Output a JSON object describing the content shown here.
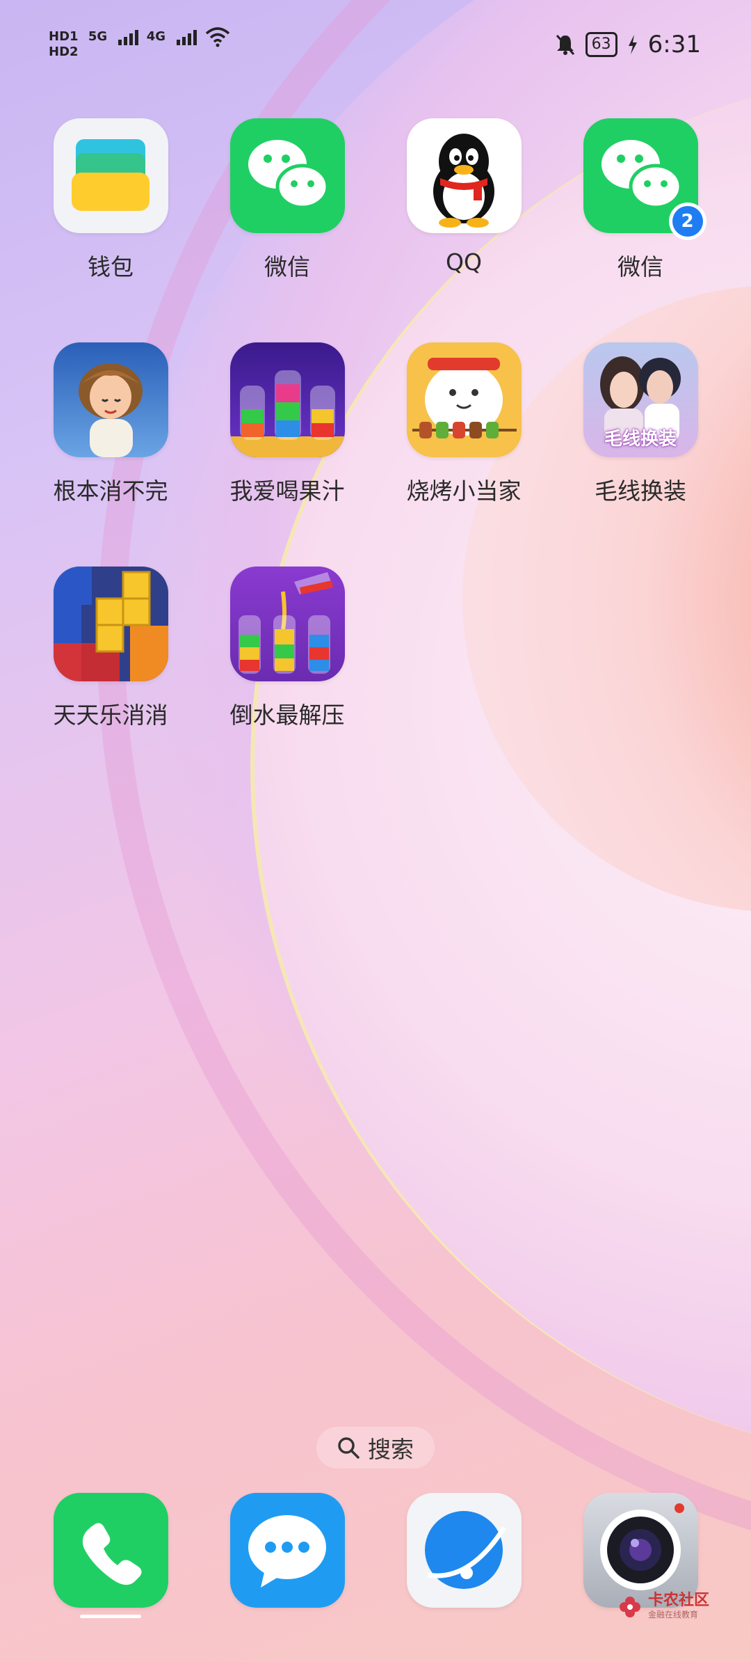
{
  "status": {
    "left_labels": [
      "HD1",
      "5G",
      "4G"
    ],
    "sub_labels": [
      "HD2"
    ],
    "battery": "63",
    "time": "6:31"
  },
  "apps": [
    {
      "label": "钱包",
      "icon": "wallet-icon"
    },
    {
      "label": "微信",
      "icon": "wechat-icon"
    },
    {
      "label": "QQ",
      "icon": "qq-penguin-icon"
    },
    {
      "label": "微信",
      "icon": "wechat-icon",
      "badge": "2"
    },
    {
      "label": "根本消不完",
      "icon": "cartoon-girl-icon"
    },
    {
      "label": "我爱喝果汁",
      "icon": "juice-bottles-icon"
    },
    {
      "label": "烧烤小当家",
      "icon": "bbq-chef-icon"
    },
    {
      "label": "毛线换装",
      "icon": "couple-dressup-icon",
      "icon_text": "毛线换装"
    },
    {
      "label": "天天乐消消",
      "icon": "block-puzzle-icon"
    },
    {
      "label": "倒水最解压",
      "icon": "water-sort-icon"
    }
  ],
  "search": {
    "label": "搜索"
  },
  "dock": [
    {
      "name": "phone",
      "icon": "phone-icon"
    },
    {
      "name": "messages",
      "icon": "message-bubble-icon"
    },
    {
      "name": "browser",
      "icon": "browser-globe-icon"
    },
    {
      "name": "camera",
      "icon": "camera-icon"
    }
  ],
  "watermark": {
    "title": "卡农社区",
    "subtitle": "金融在线教育"
  }
}
